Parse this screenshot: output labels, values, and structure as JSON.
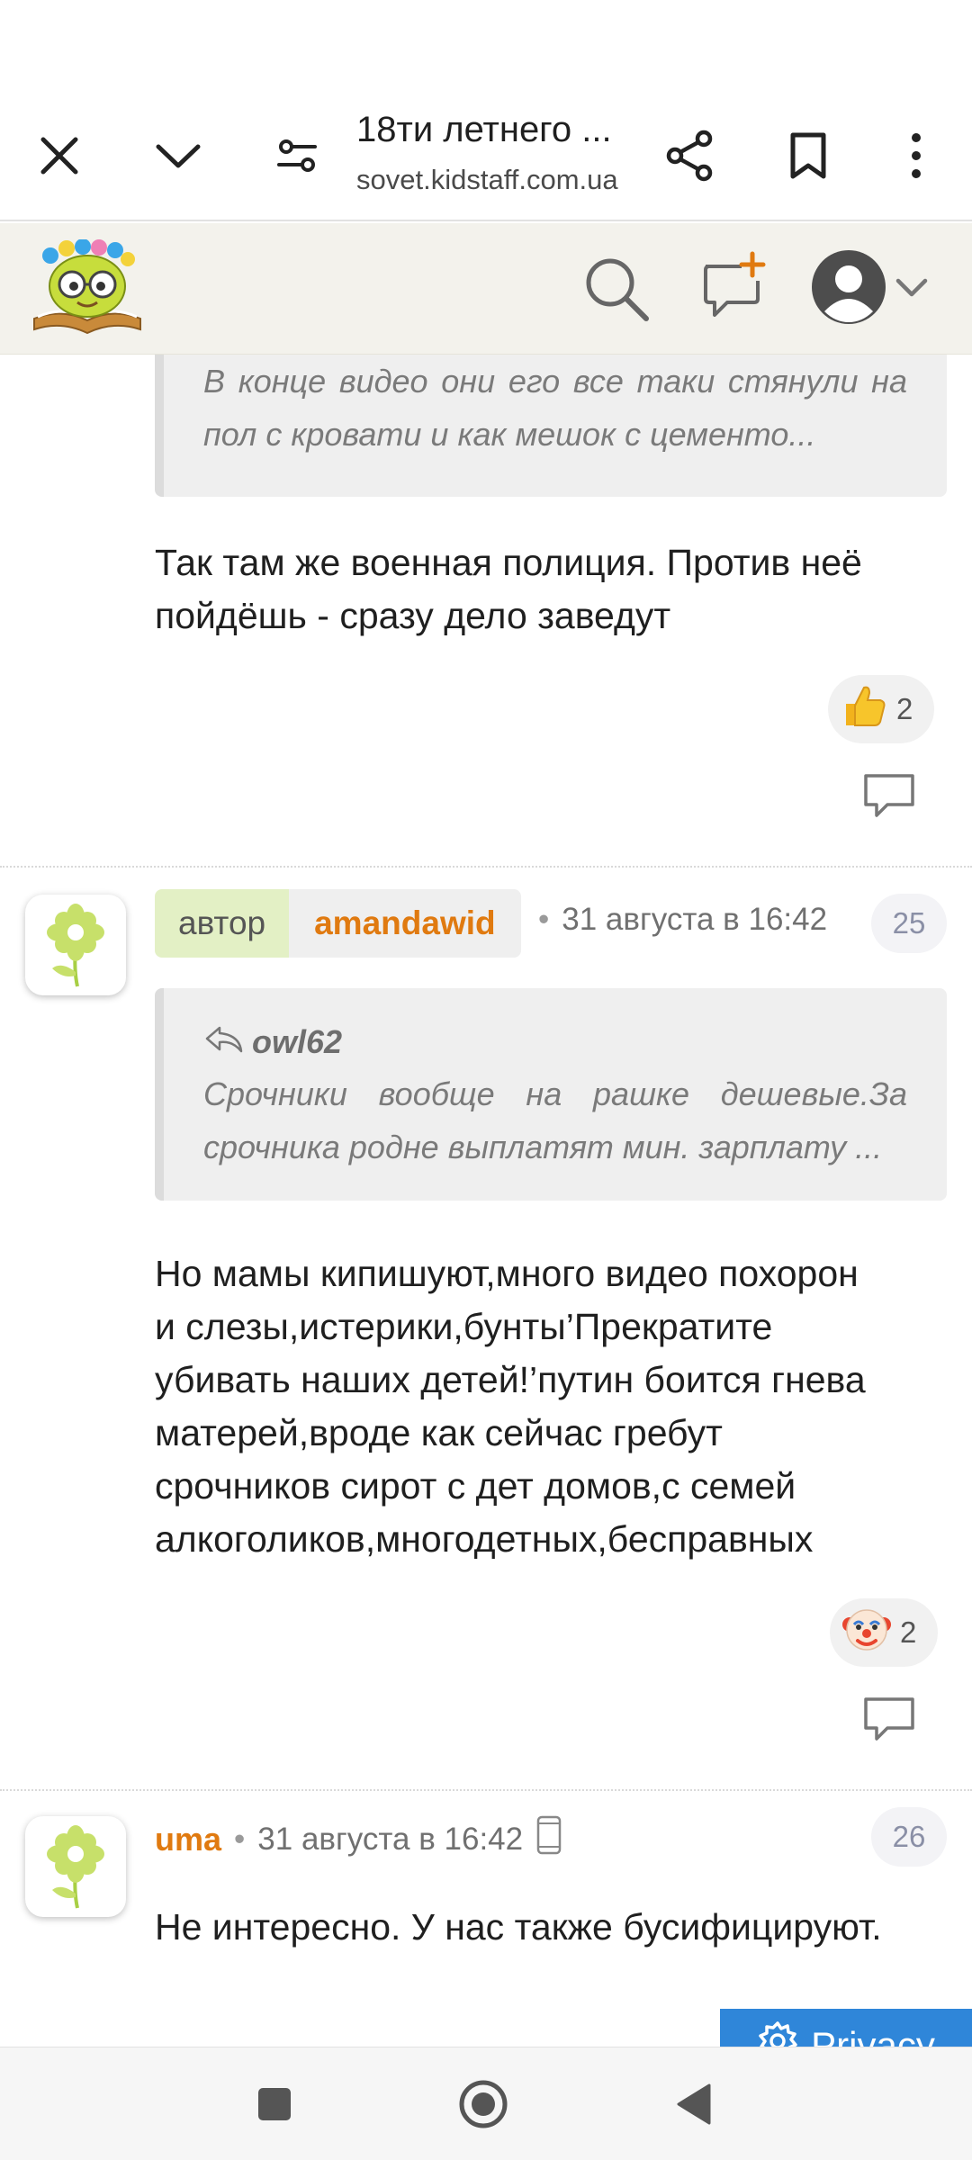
{
  "browser": {
    "title": "18ти летнего ...",
    "url": "sovet.kidstaff.com.ua"
  },
  "posts": [
    {
      "quote_lines": [
        "В конце видео они его все таки стянули на",
        "пол с кровати и как мешок с цементо..."
      ],
      "text_lines": [
        "Так там же военная полиция. Против неё",
        "пойдёшь - сразу дело заведут"
      ],
      "reaction_count": "2"
    },
    {
      "author_badge": "автор",
      "username": "amandawid",
      "time": "31 августа в 16:42",
      "number": "25",
      "quote_author": "owl62",
      "quote_lines": [
        "Срочники вообще на рашке дешевые.За",
        "срочника родне выплатят мин. зарплату ..."
      ],
      "text_lines": [
        "Но мамы кипишуют,много видео похорон",
        "и слезы,истерики,бунты’Прекратите",
        "убивать наших детей!’путин боится гнева",
        "матерей,вроде как сейчас гребут",
        "срочников сирот с дет домов,с семей",
        "алкоголиков,многодетных,бесправных"
      ],
      "reaction_count": "2"
    },
    {
      "username": "uma",
      "time": "31 августа в 16:42",
      "number": "26",
      "text_lines": [
        "Не интересно. У нас также бусифицируют."
      ]
    }
  ],
  "privacy_label": "Privacy",
  "colors": {
    "accent_orange": "#e07a10",
    "privacy_blue": "#2f86d9",
    "header_bg": "#f3f2ec"
  }
}
